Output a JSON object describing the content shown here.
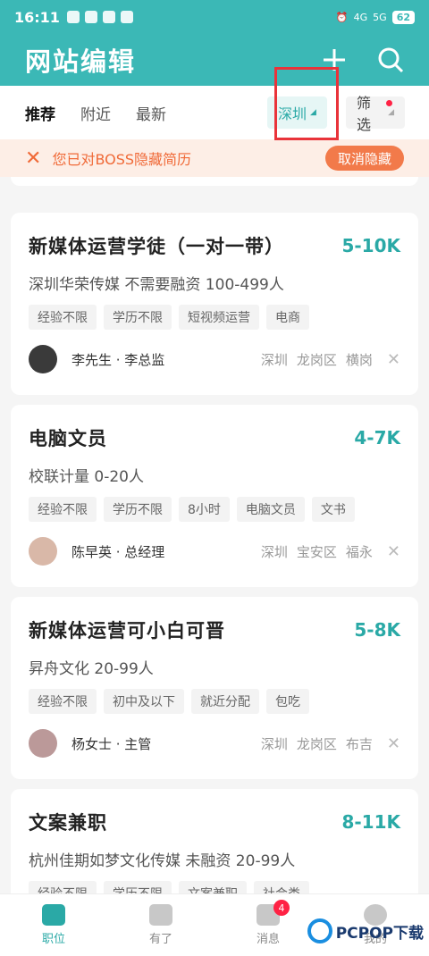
{
  "status_bar": {
    "time": "16:11",
    "battery": "62",
    "network": "4G",
    "network2": "5G"
  },
  "header": {
    "title": "网站编辑"
  },
  "tabs": [
    {
      "label": "推荐",
      "active": true
    },
    {
      "label": "附近",
      "active": false
    },
    {
      "label": "最新",
      "active": false
    }
  ],
  "city_filter": {
    "label": "深圳"
  },
  "filter_button": {
    "label": "筛选"
  },
  "notice": {
    "text": "您已对BOSS隐藏简历",
    "action": "取消隐藏"
  },
  "jobs": [
    {
      "title": "新媒体运营学徒（一对一带）",
      "salary": "5-10K",
      "company": "深圳华荣传媒  不需要融资  100-499人",
      "tags": [
        "经验不限",
        "学历不限",
        "短视频运营",
        "电商"
      ],
      "recruiter": "李先生 · 李总监",
      "location": [
        "深圳",
        "龙岗区",
        "横岗"
      ]
    },
    {
      "title": "电脑文员",
      "salary": "4-7K",
      "company": "校联计量  0-20人",
      "tags": [
        "经验不限",
        "学历不限",
        "8小时",
        "电脑文员",
        "文书"
      ],
      "recruiter": "陈早英 · 总经理",
      "location": [
        "深圳",
        "宝安区",
        "福永"
      ]
    },
    {
      "title": "新媒体运营可小白可晋",
      "salary": "5-8K",
      "company": "昇舟文化  20-99人",
      "tags": [
        "经验不限",
        "初中及以下",
        "就近分配",
        "包吃"
      ],
      "recruiter": "杨女士 · 主管",
      "location": [
        "深圳",
        "龙岗区",
        "布吉"
      ]
    },
    {
      "title": "文案兼职",
      "salary": "8-11K",
      "company": "杭州佳期如梦文化传媒  未融资  20-99人",
      "tags": [
        "经验不限",
        "学历不限",
        "文案兼职",
        "社会类"
      ],
      "recruiter": "",
      "location": []
    }
  ],
  "bottom_nav": [
    {
      "label": "职位",
      "active": true
    },
    {
      "label": "有了",
      "active": false
    },
    {
      "label": "消息",
      "active": false,
      "badge": "4"
    },
    {
      "label": "我的",
      "active": false
    }
  ],
  "watermark": {
    "text": "PCPOP下载"
  }
}
